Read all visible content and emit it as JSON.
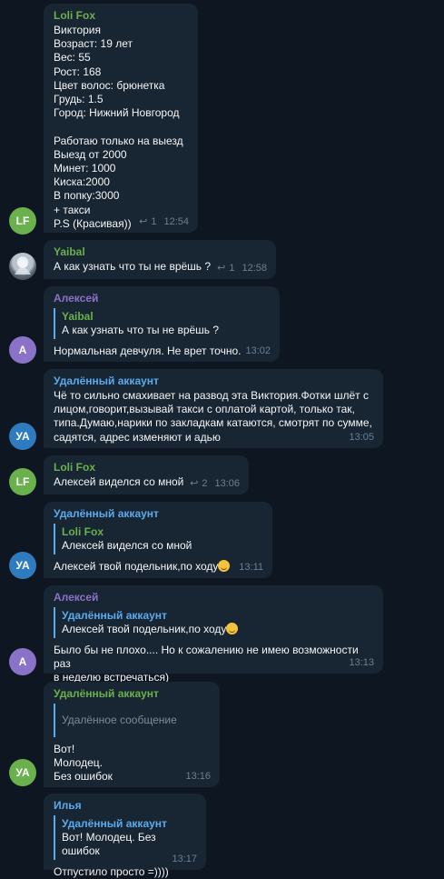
{
  "colors": {
    "bg": "#0e1621",
    "bubble": "#182533",
    "green": "#6ab04c",
    "purple": "#8b72c9",
    "blue": "#2f7bbf",
    "reply_bar": "#5aaaec"
  },
  "messages": [
    {
      "sender": "Loli Fox",
      "avatar_text": "LF",
      "text": "Виктория\nВозраст: 19 лет\nВес: 55\nРост: 168\nЦвет волос: брюнетка\nГрудь: 1.5\nГород: Нижний Новгород\n\nРаботаю только на выезд\nВыезд от 2000\nМинет: 1000\nКиска:2000\nВ попку:3000\n+ такси\nP.S (Красивая))",
      "replies_count": "1",
      "time": "12:54"
    },
    {
      "sender": "Yaibal",
      "text": "А как узнать что ты не врёшь ?",
      "replies_count": "1",
      "time": "12:58"
    },
    {
      "sender": "Алексей",
      "avatar_text": "А",
      "quote_sender": "Yaibal",
      "quote_text": "А как узнать что ты не врёшь ?",
      "text": "Нормальная девчуля. Не врет точно.",
      "time": "13:02"
    },
    {
      "sender": "Удалённый аккаунт",
      "avatar_text": "УА",
      "text": "Чё то сильно смахивает на развод эта Виктория.Фотки шлёт с\nлицом,говорит,вызывай такси с оплатой картой, только так,\nтипа.Думаю,нарики по закладкам катаются, смотрят по сумме,\nсадятся, адрес изменяют и адью",
      "time": "13:05"
    },
    {
      "sender": "Loli Fox",
      "avatar_text": "LF",
      "text": "Алексей виделся со мной",
      "replies_count": "2",
      "time": "13:06"
    },
    {
      "sender": "Удалённый аккаунт",
      "avatar_text": "УА",
      "quote_sender": "Loli Fox",
      "quote_text": "Алексей виделся со мной",
      "text": "Алексей твой подельник,по ходу",
      "time": "13:11"
    },
    {
      "sender": "Алексей",
      "avatar_text": "А",
      "quote_sender": "Удалённый аккаунт",
      "quote_text": "Алексей твой подельник,по ходу",
      "text": "Было бы не плохо.... Но к сожалению не имею возможности раз\nв неделю встречаться)",
      "time": "13:13"
    },
    {
      "sender": "Удалённый аккаунт",
      "avatar_text": "УА",
      "quote_text": "Удалённое сообщение",
      "text": "Вот!\nМолодец.\nБез ошибок",
      "time": "13:16"
    },
    {
      "sender": "Илья",
      "quote_sender": "Удалённый аккаунт",
      "quote_text": "Вот! Молодец. Без ошибок",
      "text": "Отпустило просто =))))",
      "time": "13:17"
    }
  ]
}
